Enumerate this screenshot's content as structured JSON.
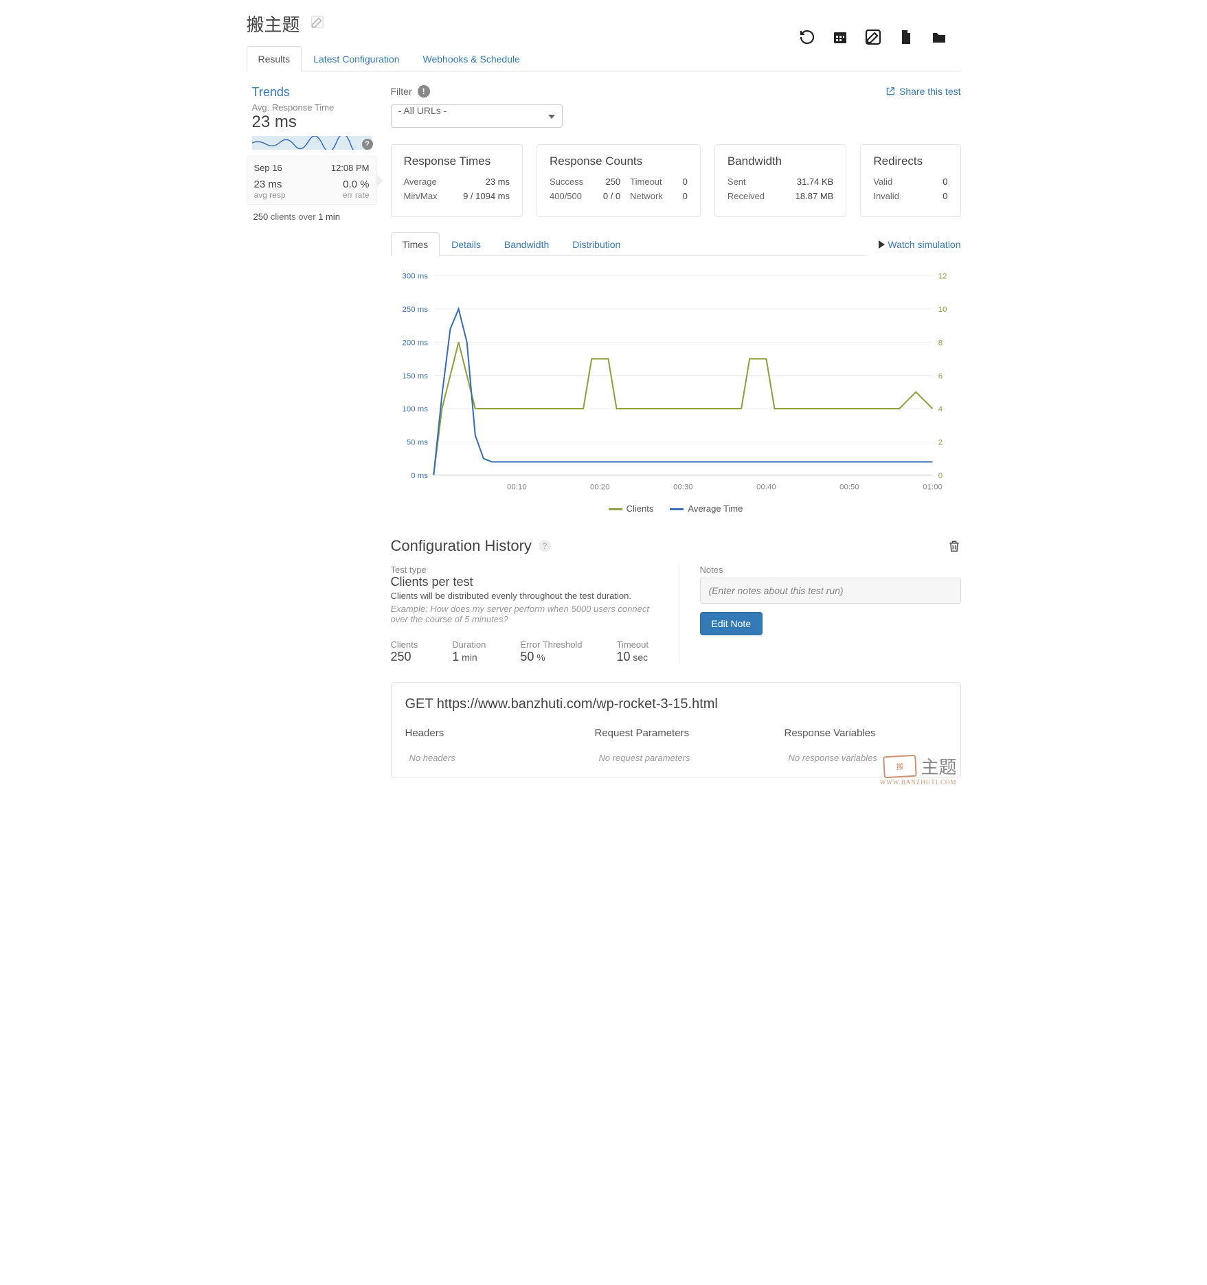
{
  "title": "搬主题",
  "header_icons": [
    "refresh-icon",
    "calendar-icon",
    "edit-icon",
    "file-icon",
    "folder-icon"
  ],
  "main_tabs": {
    "results": "Results",
    "config": "Latest Configuration",
    "webhooks": "Webhooks & Schedule"
  },
  "trends": {
    "title": "Trends",
    "subtitle": "Avg. Response Time",
    "value": "23 ms"
  },
  "run": {
    "date": "Sep 16",
    "time": "12:08 PM",
    "avg": "23 ms",
    "err": "0.0 %",
    "avg_lbl": "avg resp",
    "err_lbl": "err rate",
    "summary_num": "250",
    "summary_mid": " clients over ",
    "summary_dur": "1 min"
  },
  "filter": {
    "label": "Filter",
    "selected": "- All URLs -",
    "share": "Share this test"
  },
  "summary": {
    "rt": {
      "title": "Response Times",
      "avg_lbl": "Average",
      "avg": "23 ms",
      "mm_lbl": "Min/Max",
      "mm": "9 / 1094 ms"
    },
    "rc": {
      "title": "Response Counts",
      "s": "Success",
      "sv": "250",
      "t": "Timeout",
      "tv": "0",
      "f": "400/500",
      "fv": "0 / 0",
      "n": "Network",
      "nv": "0"
    },
    "bw": {
      "title": "Bandwidth",
      "s": "Sent",
      "sv": "31.74 KB",
      "r": "Received",
      "rv": "18.87 MB"
    },
    "rd": {
      "title": "Redirects",
      "v": "Valid",
      "vv": "0",
      "i": "Invalid",
      "iv": "0"
    }
  },
  "sub_tabs": {
    "times": "Times",
    "details": "Details",
    "bandwidth": "Bandwidth",
    "distribution": "Distribution"
  },
  "watch_link": "Watch simulation",
  "chart_legend": {
    "clients": "Clients",
    "avg": "Average Time"
  },
  "chart_data": {
    "type": "line",
    "x_ticks": [
      "00:10",
      "00:20",
      "00:30",
      "00:40",
      "00:50",
      "01:00"
    ],
    "y_left_label": "ms",
    "y_left_ticks": [
      0,
      50,
      100,
      150,
      200,
      250,
      300
    ],
    "y_right_ticks": [
      0,
      2,
      4,
      6,
      8,
      10,
      12
    ],
    "series": [
      {
        "name": "Clients",
        "axis": "right",
        "color": "#8ea23f",
        "x": [
          0,
          1,
          2,
          3,
          4,
          5,
          18,
          19,
          21,
          22,
          23,
          37,
          38,
          40,
          41,
          42,
          56,
          57,
          58,
          59,
          60
        ],
        "y": [
          0,
          4,
          6,
          8,
          6,
          4,
          4,
          7,
          7,
          4,
          4,
          4,
          7,
          7,
          4,
          4,
          4,
          4.5,
          5,
          4.5,
          4
        ]
      },
      {
        "name": "Average Time",
        "axis": "left",
        "color": "#3b6fb5",
        "x": [
          0,
          1,
          2,
          3,
          4,
          5,
          6,
          7,
          60
        ],
        "y": [
          0,
          120,
          220,
          250,
          200,
          60,
          25,
          20,
          20
        ]
      }
    ],
    "xrange": [
      0,
      60
    ],
    "yleft_range": [
      0,
      300
    ],
    "yright_range": [
      0,
      12
    ]
  },
  "cfg": {
    "title": "Configuration History",
    "type_lbl": "Test type",
    "type": "Clients per test",
    "desc": "Clients will be distributed evenly throughout the test duration.",
    "example": "Example: How does my server perform when 5000 users connect over the course of 5 minutes?",
    "stats": {
      "clients_lbl": "Clients",
      "clients": "250",
      "duration_lbl": "Duration",
      "duration": "1",
      "duration_unit": " min",
      "error_lbl": "Error Threshold",
      "error": "50",
      "error_unit": " %",
      "timeout_lbl": "Timeout",
      "timeout": "10",
      "timeout_unit": " sec"
    },
    "notes_lbl": "Notes",
    "notes_placeholder": "(Enter notes about this test run)",
    "edit_btn": "Edit Note"
  },
  "request": {
    "line": "GET https://www.banzhuti.com/wp-rocket-3-15.html",
    "headers_lbl": "Headers",
    "headers_empty": "No headers",
    "params_lbl": "Request Parameters",
    "params_empty": "No request parameters",
    "vars_lbl": "Response Variables",
    "vars_empty": "No response variables"
  },
  "watermark": {
    "stamp": "搬",
    "text": "主题",
    "sub": "WWW.BANZHUTI.COM"
  }
}
